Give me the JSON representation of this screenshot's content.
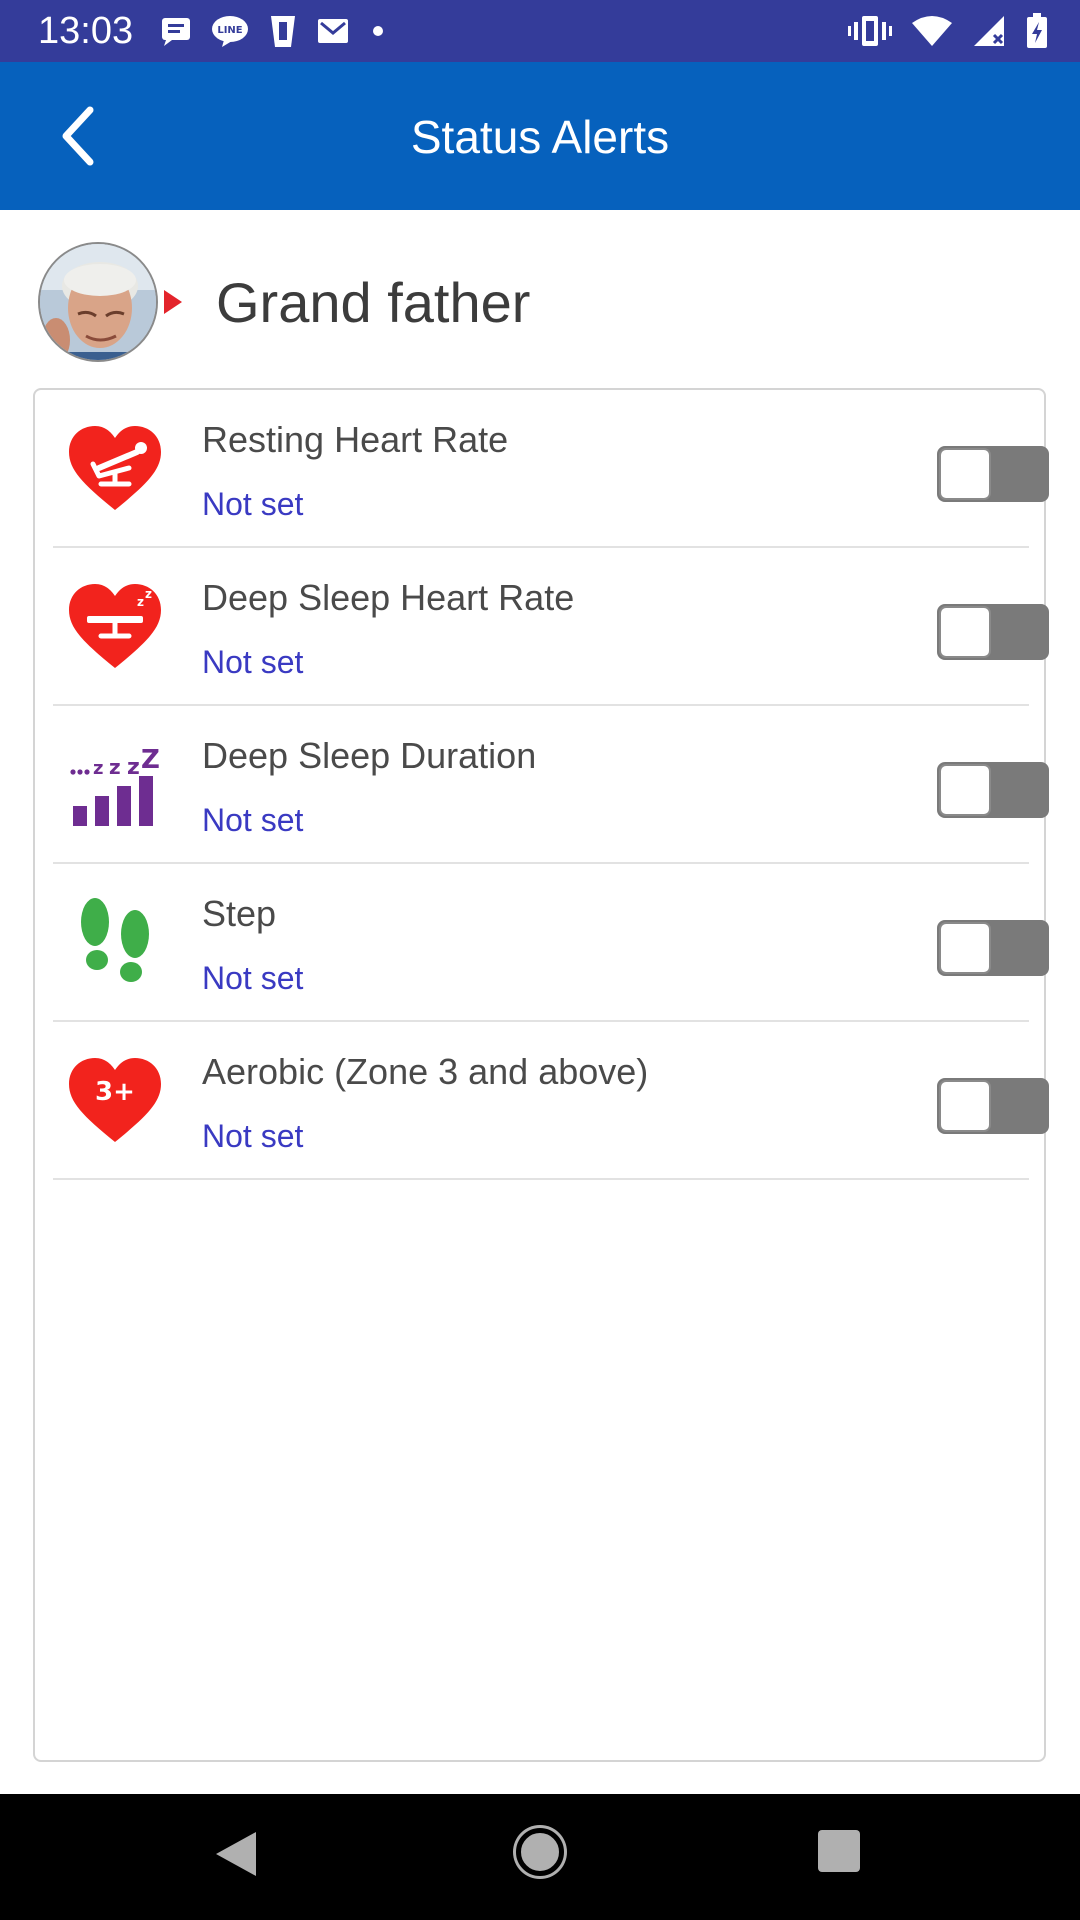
{
  "status_bar": {
    "time": "13:03",
    "left_icons": [
      "message-icon",
      "line-app-icon",
      "cup-icon",
      "gmail-icon",
      "more-dot-icon"
    ],
    "right_icons": [
      "vibrate-icon",
      "wifi-icon",
      "cell-signal-icon",
      "battery-charging-icon"
    ]
  },
  "app_bar": {
    "back_icon": "chevron-left-icon",
    "title": "Status Alerts"
  },
  "profile": {
    "name": "Grand father",
    "avatar": "avatar-photo"
  },
  "alerts": [
    {
      "icon": "resting-heart-icon",
      "title": "Resting Heart Rate",
      "status": "Not set",
      "enabled": false
    },
    {
      "icon": "sleep-heart-icon",
      "title": "Deep Sleep Heart Rate",
      "status": "Not set",
      "enabled": false
    },
    {
      "icon": "sleep-duration-icon",
      "title": "Deep Sleep Duration",
      "status": "Not set",
      "enabled": false
    },
    {
      "icon": "footsteps-icon",
      "title": "Step",
      "status": "Not set",
      "enabled": false
    },
    {
      "icon": "aerobic-heart-icon",
      "title": "Aerobic (Zone 3 and above)",
      "status": "Not set",
      "enabled": false
    }
  ],
  "icon_glyphs": {
    "aerobic_label": "3+"
  },
  "colors": {
    "status_bar": "#343c9a",
    "app_bar": "#0661bd",
    "heart_red": "#f2231d",
    "sleep_purple": "#6e2d91",
    "step_green": "#3fae49",
    "status_text": "#3a3ac2",
    "toggle_off": "#7a7a7a"
  },
  "nav_bar": {
    "buttons": [
      "nav-back-button",
      "nav-home-button",
      "nav-recents-button"
    ]
  }
}
